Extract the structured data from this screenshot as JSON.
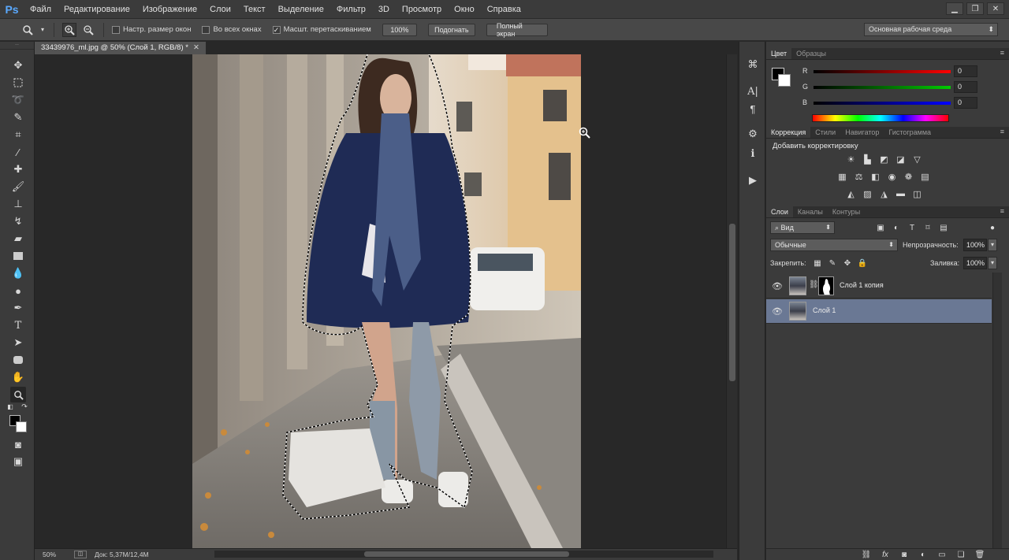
{
  "menu": {
    "logo": "Ps",
    "items": [
      "Файл",
      "Редактирование",
      "Изображение",
      "Слои",
      "Текст",
      "Выделение",
      "Фильтр",
      "3D",
      "Просмотр",
      "Окно",
      "Справка"
    ]
  },
  "window_controls": {
    "minimize": "▁",
    "restore": "❐",
    "close": "✕"
  },
  "options": {
    "resize_windows": "Настр. размер окон",
    "all_windows": "Во всех окнах",
    "scrubby_zoom": "Масшт. перетаскиванием",
    "scrubby_zoom_checked": true,
    "btn_100": "100%",
    "btn_fit": "Подогнать",
    "btn_fullscreen": "Полный экран",
    "workspace": "Основная рабочая среда"
  },
  "document": {
    "tab_title": "33439976_ml.jpg @ 50% (Слой 1, RGB/8) *",
    "zoom": "50%",
    "doc_info": "Док: 5,37M/12,4M"
  },
  "color_panel": {
    "tabs": [
      "Цвет",
      "Образцы"
    ],
    "r_label": "R",
    "g_label": "G",
    "b_label": "B",
    "r": "0",
    "g": "0",
    "b": "0",
    "foreground": "#000000",
    "background": "#ffffff"
  },
  "correction_panel": {
    "tabs": [
      "Коррекция",
      "Стили",
      "Навигатор",
      "Гистограмма"
    ],
    "title": "Добавить корректировку"
  },
  "layers_panel": {
    "tabs": [
      "Слои",
      "Каналы",
      "Контуры"
    ],
    "filter_kind": "Вид",
    "blend_mode": "Обычные",
    "opacity_label": "Непрозрачность:",
    "opacity": "100%",
    "lock_label": "Закрепить:",
    "fill_label": "Заливка:",
    "fill": "100%",
    "layers": [
      {
        "name": "Слой 1 копия",
        "visible": true,
        "selected": false,
        "has_mask": true
      },
      {
        "name": "Слой 1",
        "visible": true,
        "selected": true,
        "has_mask": false
      }
    ]
  },
  "colors": {
    "selected_layer": "#6a7894",
    "ps_logo": "#5aa9ff"
  }
}
